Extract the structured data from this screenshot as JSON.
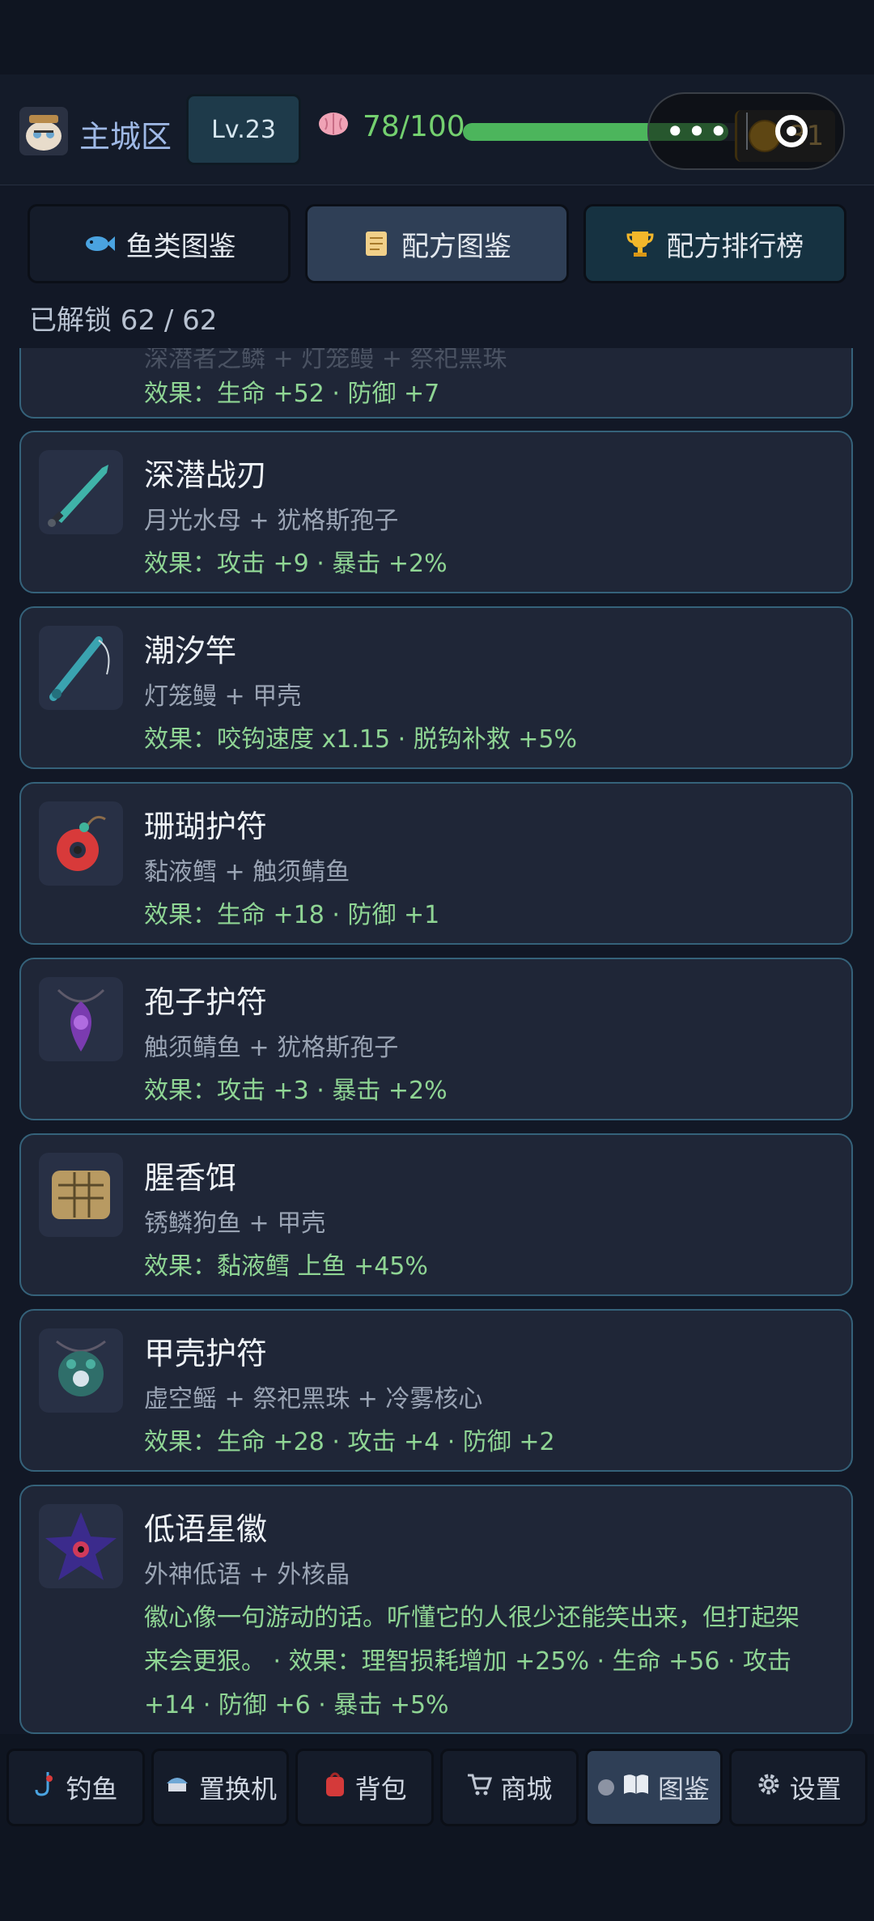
{
  "topbar": {
    "zone": "主城区",
    "level": "Lv.23",
    "sanity_text": "78/100",
    "sanity_fraction": 0.78,
    "coins": "31"
  },
  "tabs": [
    {
      "label": "鱼类图鉴",
      "icon": "fish-icon"
    },
    {
      "label": "配方图鉴",
      "icon": "scroll-icon"
    },
    {
      "label": "配方排行榜",
      "icon": "trophy-icon"
    }
  ],
  "unlocked": "已解锁 62 / 62",
  "cards": [
    {
      "name": "",
      "recipe": "深潜者之鳞 + 灯笼鳗 + 祭祀黑珠",
      "effect": "效果：生命 +52 · 防御 +7",
      "icon": "partial-item-icon"
    },
    {
      "name": "深潜战刃",
      "recipe": "月光水母 + 犹格斯孢子",
      "effect": "效果：攻击 +9 · 暴击 +2%",
      "icon": "sword-icon"
    },
    {
      "name": "潮汐竿",
      "recipe": "灯笼鳗 + 甲壳",
      "effect": "效果：咬钩速度 x1.15 · 脱钩补救 +5%",
      "icon": "fishing-rod-icon"
    },
    {
      "name": "珊瑚护符",
      "recipe": "黏液鳕 + 触须鲭鱼",
      "effect": "效果：生命 +18 · 防御 +1",
      "icon": "coral-amulet-icon"
    },
    {
      "name": "孢子护符",
      "recipe": "触须鲭鱼 + 犹格斯孢子",
      "effect": "效果：攻击 +3 · 暴击 +2%",
      "icon": "spore-amulet-icon"
    },
    {
      "name": "腥香饵",
      "recipe": "锈鳞狗鱼 + 甲壳",
      "effect": "效果：黏液鳕 上鱼 +45%",
      "icon": "bait-icon"
    },
    {
      "name": "甲壳护符",
      "recipe": "虚空鳐 + 祭祀黑珠 + 冷雾核心",
      "effect": "效果：生命 +28 · 攻击 +4 · 防御 +2",
      "icon": "shell-amulet-icon"
    },
    {
      "name": "低语星徽",
      "recipe": "外神低语 + 外核晶",
      "effect": "徽心像一句游动的话。听懂它的人很少还能笑出来，但打起架来会更狠。 · 效果：理智损耗增加 +25% · 生命 +56 · 攻击 +14 · 防御 +6 · 暴击 +5%",
      "icon": "star-emblem-icon"
    }
  ],
  "nav": [
    {
      "label": "钓鱼",
      "icon": "hook-icon"
    },
    {
      "label": "置换机",
      "icon": "exchange-machine-icon"
    },
    {
      "label": "背包",
      "icon": "backpack-icon"
    },
    {
      "label": "商城",
      "icon": "cart-icon"
    },
    {
      "label": "图鉴",
      "icon": "book-icon"
    },
    {
      "label": "设置",
      "icon": "gear-icon"
    }
  ],
  "colors": {
    "background": "#121826",
    "card": "#1f2637",
    "card_border": "#35627a",
    "effect_green": "#8fd594",
    "sanity_green": "#4cb55c",
    "gold": "#c6911f"
  }
}
